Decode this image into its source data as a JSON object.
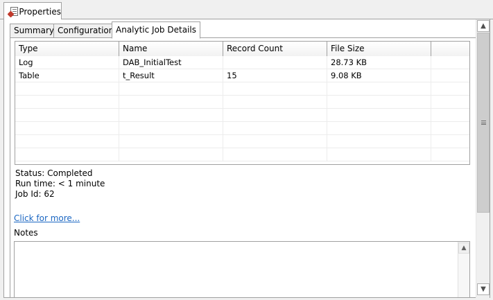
{
  "view": {
    "tab_label": "Properties",
    "icon": "properties-icon"
  },
  "tabs": [
    {
      "label": "Summary",
      "active": false
    },
    {
      "label": "Configuration",
      "active": false
    },
    {
      "label": "Analytic Job Details",
      "active": true
    }
  ],
  "table": {
    "columns": [
      "Type",
      "Name",
      "Record Count",
      "File Size"
    ],
    "rows": [
      [
        "Log",
        "DAB_InitialTest",
        "",
        "28.73 KB"
      ],
      [
        "Table",
        "t_Result",
        "15",
        "9.08 KB"
      ]
    ],
    "empty_rows": 6
  },
  "status": {
    "status_line": "Status: Completed",
    "runtime_line": "Run time:  < 1 minute",
    "jobid_line": "Job Id: 62"
  },
  "more_link": "Click for more...",
  "notes": {
    "label": "Notes",
    "value": ""
  },
  "icons": {
    "scroll_up": "▲",
    "scroll_down": "▼",
    "scroll_up_small": "▲"
  }
}
